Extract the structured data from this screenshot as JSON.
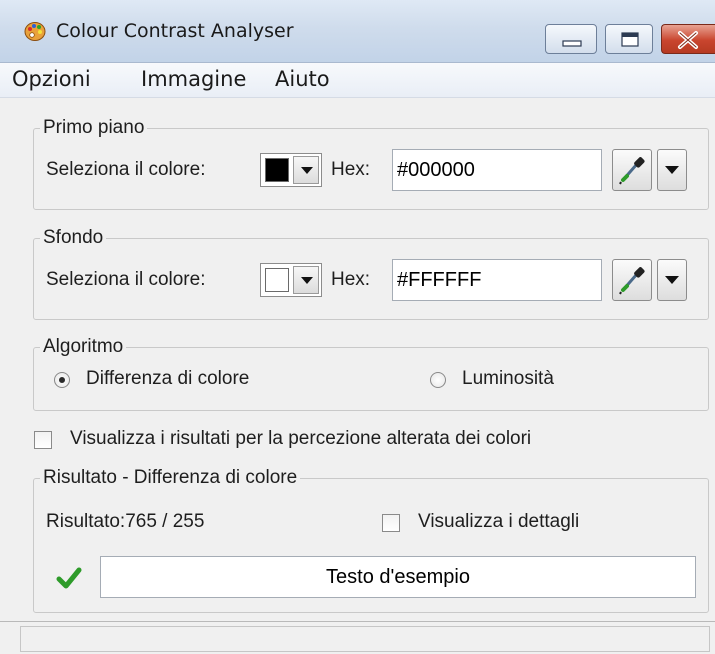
{
  "window": {
    "title": "Colour Contrast Analyser",
    "controls": {
      "minimize_icon": "minimize-icon",
      "maximize_icon": "maximize-icon",
      "close_icon": "close-icon"
    }
  },
  "menu": {
    "items": [
      {
        "label": "Opzioni"
      },
      {
        "label": "Immagine"
      },
      {
        "label": "Aiuto"
      }
    ]
  },
  "foreground": {
    "title": "Primo piano",
    "select_label": "Seleziona il colore:",
    "swatch_color": "#000000",
    "hex_label": "Hex:",
    "hex_value": "#000000",
    "picker_icon": "eyedropper-icon"
  },
  "background": {
    "title": "Sfondo",
    "select_label": "Seleziona il colore:",
    "swatch_color": "#FFFFFF",
    "hex_label": "Hex:",
    "hex_value": "#FFFFFF",
    "picker_icon": "eyedropper-icon"
  },
  "algorithm": {
    "title": "Algoritmo",
    "options": [
      {
        "label": "Differenza di colore",
        "selected": true
      },
      {
        "label": "Luminosità",
        "selected": false
      }
    ]
  },
  "altered_perception": {
    "label": "Visualizza i risultati per la percezione alterata dei colori",
    "checked": false
  },
  "result": {
    "title": "Risultato - Differenza di colore",
    "text": "Risultato:765 / 255",
    "details_label": "Visualizza i dettagli",
    "details_checked": false,
    "status_icon": "checkmark-icon",
    "sample_text": "Testo d'esempio"
  },
  "colors": {
    "titlebar": "#c2d3e8",
    "window_bg": "#f0f0f0",
    "check_green": "#2e9b2a",
    "close_red": "#c9452e"
  }
}
